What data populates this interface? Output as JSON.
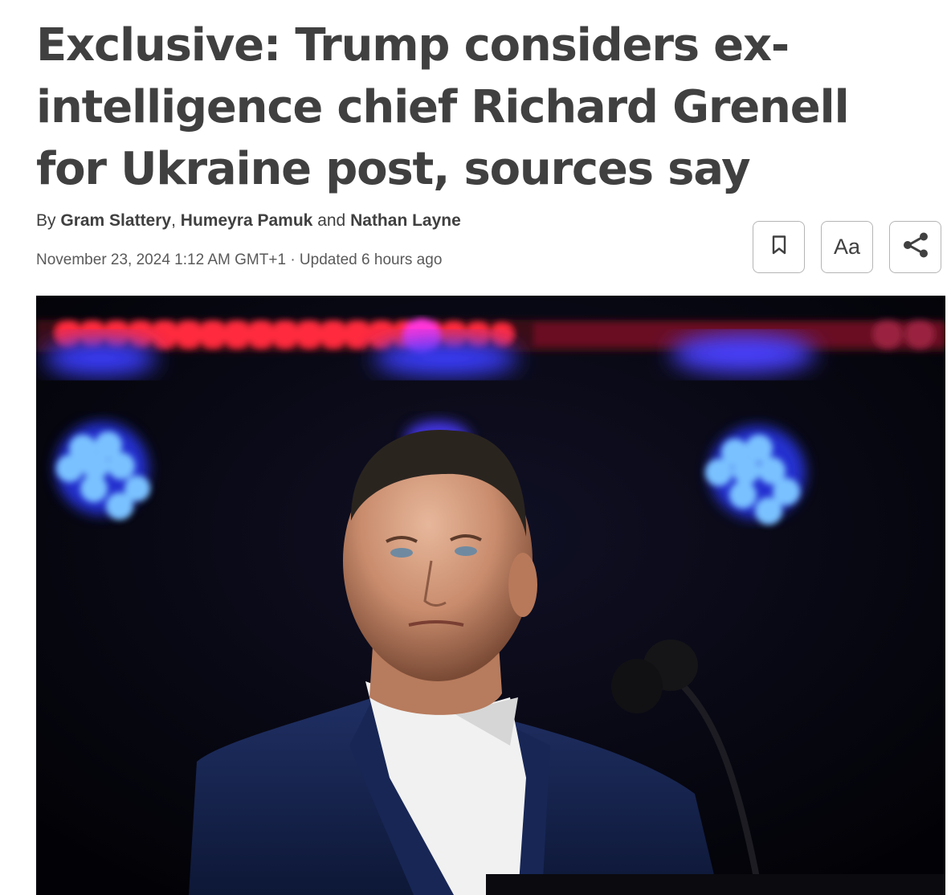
{
  "article": {
    "headline": "Exclusive: Trump considers ex-intelligence chief Richard Grenell for Ukraine post, sources say",
    "byline": {
      "prefix": "By",
      "author1": "Gram Slattery",
      "sep1": ",",
      "author2": "Humeyra Pamuk",
      "conj": "and",
      "author3": "Nathan Layne"
    },
    "date": "November 23, 2024 1:12 AM GMT+1",
    "updated": "· Updated 6 hours ago"
  },
  "toolbar": {
    "bookmark_icon": "bookmark-icon",
    "text_size_label": "Aa",
    "share_icon": "share-icon"
  },
  "colors": {
    "text": "#404040",
    "muted": "#5a5a5a",
    "border": "#b5b5b5",
    "photo_bg": "#05050d"
  }
}
